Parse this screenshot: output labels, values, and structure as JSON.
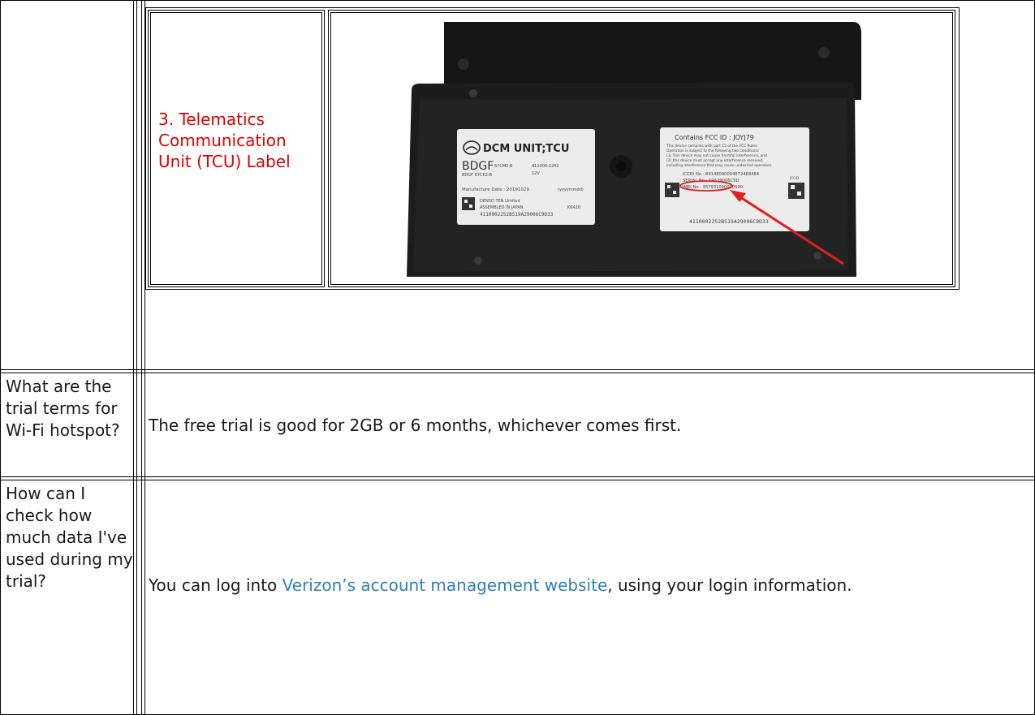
{
  "top_row": {
    "label_title": "3. Telematics Communication Unit (TCU) Label",
    "photo": {
      "left_label": {
        "brand_text": "DCM UNIT;TCU",
        "model": "BDGF",
        "part_a": "67CM0-B",
        "part_b": "411000-2252",
        "part_c": "BDGF 67CK2-B",
        "voltage": "12V",
        "mfg_date": "Manufacture Date : 20191029",
        "date_format": "(yyyymmdd)",
        "maker": "DENSO TEN Limited",
        "assembled": "ASSEMBLED IN JAPAN",
        "code": "K6420",
        "serial_line": "4110002252BS19A29006C9D33"
      },
      "right_label": {
        "fcc": "Contains FCC ID : JOYJ79",
        "line1": "This device complies with part 15 of the FCC Rules.",
        "line2": "Operation is subject to the following two conditions:",
        "line3": "(1) This device may not cause harmful interference, and",
        "line4": "(2) this device must accept any interference received,",
        "line5": "including interference that may cause undesired operation.",
        "iccid": "ICCID No : 89148000004672468484",
        "serial": "SERIAL No : 19A29006C9D",
        "imei": "IMEI No : 357931090000000",
        "bottom": "4110002252BS19A29006C9D33",
        "iccid_tag": "ICCID"
      }
    }
  },
  "faq": [
    {
      "question": "What are the trial terms for Wi-Fi hotspot?",
      "answer": "The free trial is good for 2GB or 6 months, whichever comes first."
    },
    {
      "question": "How can I check how much data I've used during my trial?",
      "answer_before": "You can log into ",
      "answer_link": "Verizon’s account management website",
      "answer_after": ", using your login information."
    }
  ],
  "colors": {
    "label_red": "#e00000",
    "link_blue": "#2e7fb9",
    "device_black": "#1c1c1c"
  }
}
